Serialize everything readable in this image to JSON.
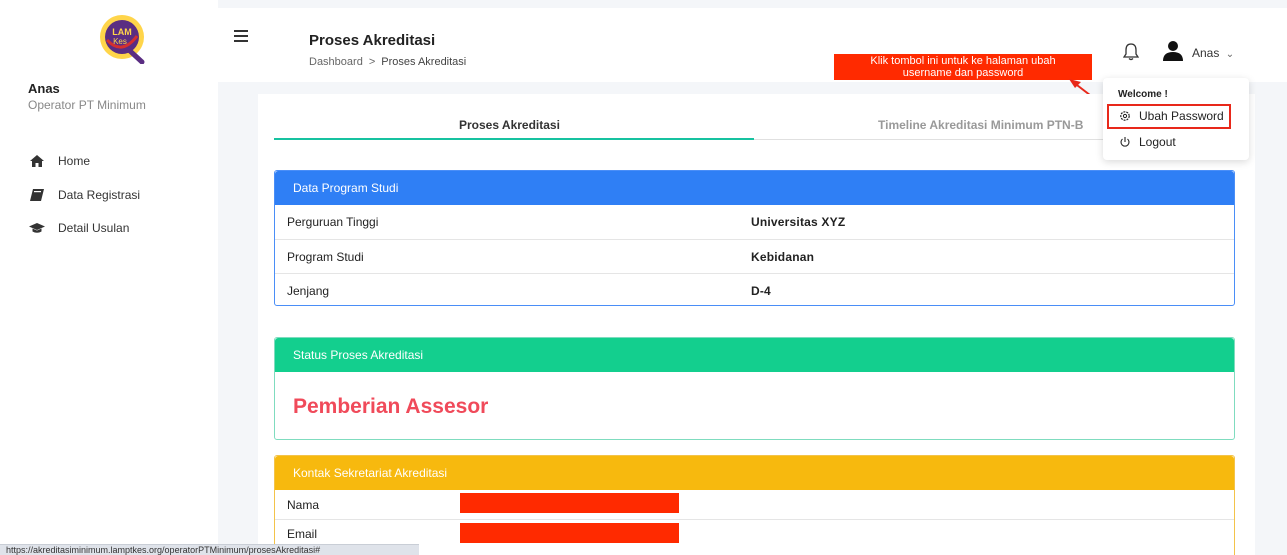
{
  "sidebar": {
    "logo_text": "LAM Kes",
    "user_name": "Anas",
    "user_role": "Operator PT Minimum",
    "items": [
      {
        "label": "Home",
        "icon": "home-icon"
      },
      {
        "label": "Data Registrasi",
        "icon": "book-icon"
      },
      {
        "label": "Detail Usulan",
        "icon": "graduation-cap-icon"
      }
    ]
  },
  "header": {
    "title": "Proses Akreditasi",
    "breadcrumb": [
      "Dashboard",
      "Proses Akreditasi"
    ],
    "breadcrumb_sep": ">",
    "user_label": "Anas",
    "chevron": "⌄"
  },
  "callout": {
    "text_line1": "Klik tombol ini untuk ke halaman ubah",
    "text_line2": "username dan password"
  },
  "dropdown": {
    "welcome": "Welcome !",
    "items": [
      {
        "label": "Ubah Password",
        "icon": "gear-icon"
      },
      {
        "label": "Logout",
        "icon": "power-icon"
      }
    ]
  },
  "tabs": [
    {
      "label": "Proses Akreditasi",
      "active": true
    },
    {
      "label": "Timeline Akreditasi Minimum PTN-B",
      "active": false
    }
  ],
  "program_studi": {
    "title": "Data Program Studi",
    "rows": [
      {
        "key": "Perguruan Tinggi",
        "value": "Universitas XYZ"
      },
      {
        "key": "Program Studi",
        "value": "Kebidanan"
      },
      {
        "key": "Jenjang",
        "value": "D-4"
      }
    ]
  },
  "status": {
    "title": "Status Proses Akreditasi",
    "value": "Pemberian Assesor"
  },
  "kontak": {
    "title": "Kontak Sekretariat Akreditasi",
    "rows": [
      {
        "key": "Nama"
      },
      {
        "key": "Email"
      }
    ]
  },
  "statusbar": {
    "url": "https://akreditasiminimum.lamptkes.org/operatorPTMinimum/prosesAkreditasi#"
  },
  "colors": {
    "accent_teal": "#17c2a0",
    "blue": "#2f7ff5",
    "green": "#13cf8e",
    "yellow": "#f7b90e",
    "status_red": "#f04a5a",
    "callout_red": "#ff2a00"
  }
}
